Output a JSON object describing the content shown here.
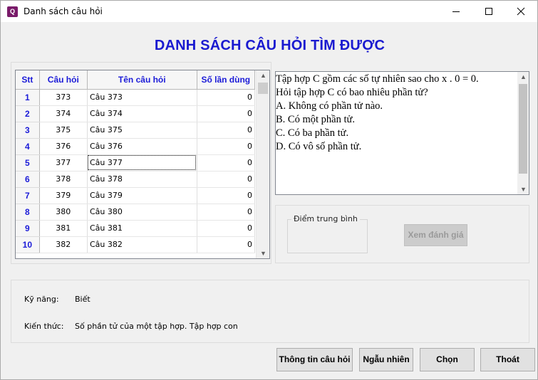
{
  "window": {
    "title": "Danh sách câu hỏi",
    "app_icon_glyph": "Q"
  },
  "heading": "DANH SÁCH CÂU HỎI TÌM ĐƯỢC",
  "grid": {
    "columns": [
      "Stt",
      "Câu hỏi",
      "Tên câu hỏi",
      "Số lần dùng"
    ],
    "rows": [
      {
        "stt": "1",
        "id": "373",
        "name": "Câu 373",
        "used": "0"
      },
      {
        "stt": "2",
        "id": "374",
        "name": "Câu 374",
        "used": "0"
      },
      {
        "stt": "3",
        "id": "375",
        "name": "Câu 375",
        "used": "0"
      },
      {
        "stt": "4",
        "id": "376",
        "name": "Câu 376",
        "used": "0"
      },
      {
        "stt": "5",
        "id": "377",
        "name": "Câu 377",
        "used": "0"
      },
      {
        "stt": "6",
        "id": "378",
        "name": "Câu 378",
        "used": "0"
      },
      {
        "stt": "7",
        "id": "379",
        "name": "Câu 379",
        "used": "0"
      },
      {
        "stt": "8",
        "id": "380",
        "name": "Câu 380",
        "used": "0"
      },
      {
        "stt": "9",
        "id": "381",
        "name": "Câu 381",
        "used": "0"
      },
      {
        "stt": "10",
        "id": "382",
        "name": "Câu 382",
        "used": "0"
      }
    ]
  },
  "question": {
    "lines": [
      "Tập hợp C gồm các số tự nhiên sao cho x . 0 = 0.",
      "Hỏi tập hợp C có bao nhiêu phần tử?",
      "A.  Không có phần tử nào.",
      "B.  Có một phần tử.",
      "C.  Có ba phần tử.",
      "D.  Có vô số phần tử."
    ]
  },
  "score": {
    "group_label": "Điểm trung bình",
    "evaluate_button": "Xem đánh giá"
  },
  "info": {
    "skill_label": "Kỹ năng:",
    "skill_value": "Biết",
    "knowledge_label": "Kiến thức:",
    "knowledge_value": "Số phần tử của một tập hợp. Tập hợp con"
  },
  "buttons": {
    "info": "Thông tin câu hỏi",
    "random": "Ngẫu nhiên",
    "choose": "Chọn",
    "exit": "Thoát"
  },
  "colors": {
    "heading": "#1a1ad0",
    "grid_header_text": "#1b1bd8"
  }
}
